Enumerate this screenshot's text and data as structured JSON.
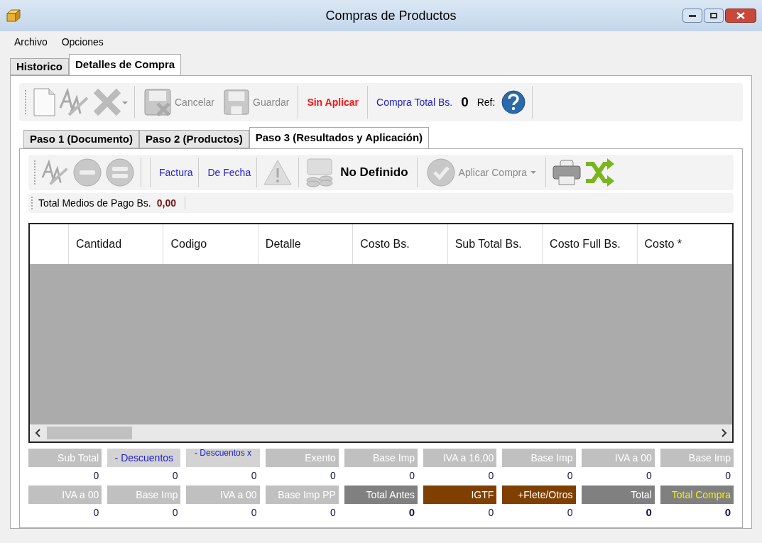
{
  "window": {
    "title": "Compras de Productos"
  },
  "menu": [
    "Archivo",
    "Opciones"
  ],
  "tabs": [
    {
      "label": "Historico",
      "selected": false
    },
    {
      "label": "Detalles de Compra",
      "selected": true
    }
  ],
  "toolbar": {
    "cancel": {
      "label": "Cancelar",
      "disabled": true
    },
    "save": {
      "label": "Guardar",
      "disabled": true
    },
    "status": "Sin Aplicar",
    "total_label": "Compra Total Bs.",
    "total_value": "0",
    "ref_label": "Ref:"
  },
  "step_tabs": [
    {
      "label": "Paso 1 (Documento)",
      "selected": false
    },
    {
      "label": "Paso 2 (Productos)",
      "selected": false
    },
    {
      "label": "Paso 3 (Resultados y Aplicación)",
      "selected": true
    }
  ],
  "step_toolbar": {
    "links": [
      "Factura",
      "De Fecha"
    ],
    "status": "No Definido",
    "apply": {
      "label": "Aplicar Compra",
      "disabled": true
    }
  },
  "payments": {
    "label": "Total Medios de Pago Bs.",
    "value": "0,00"
  },
  "table": {
    "columns": [
      "",
      "Cantidad",
      "Codigo",
      "Detalle",
      "Costo Bs.",
      "Sub Total Bs.",
      "Costo Full Bs.",
      "Costo *"
    ]
  },
  "summary": [
    [
      {
        "label": "Sub Total",
        "kind": "plain",
        "value": "0",
        "bold": false
      },
      {
        "label": "- Descuentos",
        "kind": "link",
        "value": "0",
        "bold": false
      },
      {
        "label": "- Descuentos x",
        "kind": "link-small",
        "value": "0",
        "bold": false
      },
      {
        "label": "Exento",
        "kind": "plain",
        "value": "0",
        "bold": false
      },
      {
        "label": "Base Imp",
        "kind": "plain",
        "value": "0",
        "bold": false
      },
      {
        "label": "IVA a 16,00",
        "kind": "plain",
        "value": "0",
        "bold": false
      },
      {
        "label": "Base Imp",
        "kind": "plain",
        "value": "0",
        "bold": false
      },
      {
        "label": "IVA a 00",
        "kind": "plain",
        "value": "0",
        "bold": false
      },
      {
        "label": "Base Imp",
        "kind": "plain",
        "value": "0",
        "bold": false
      }
    ],
    [
      {
        "label": "IVA a 00",
        "kind": "plain",
        "value": "0",
        "bold": false
      },
      {
        "label": "Base Imp",
        "kind": "plain",
        "value": "0",
        "bold": false
      },
      {
        "label": "IVA a 00",
        "kind": "plain",
        "value": "0",
        "bold": false
      },
      {
        "label": "Base Imp PP",
        "kind": "plain",
        "value": "0",
        "bold": false
      },
      {
        "label": "Total Antes",
        "kind": "dark",
        "value": "0",
        "bold": true
      },
      {
        "label": "IGTF",
        "kind": "brown",
        "value": "0",
        "bold": false
      },
      {
        "label": "+Flete/Otros",
        "kind": "brown",
        "value": "0",
        "bold": false
      },
      {
        "label": "Total",
        "kind": "dark",
        "value": "0",
        "bold": true
      },
      {
        "label": "Total Compra",
        "kind": "grand",
        "value": "0",
        "bold": true
      }
    ]
  ]
}
